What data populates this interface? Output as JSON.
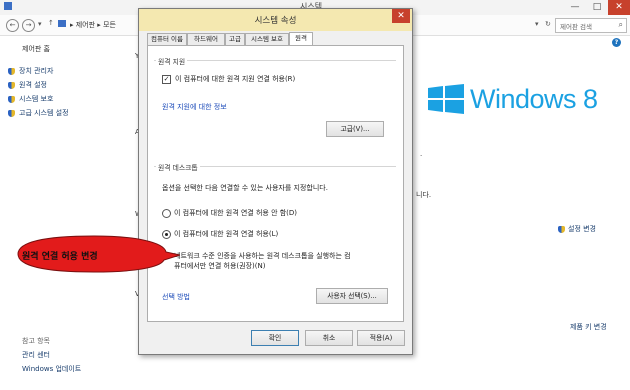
{
  "window": {
    "title": "시스템",
    "minimize": "—",
    "maximize": "□"
  },
  "address": {
    "breadcrumb": "▸ 제어판 ▸ 모든",
    "search_placeholder": "제어판 검색"
  },
  "sidebar": {
    "home": "제어판 홈",
    "items": [
      {
        "label": "장치 관리자"
      },
      {
        "label": "원격 설정"
      },
      {
        "label": "시스템 보호"
      },
      {
        "label": "고급 시스템 설정"
      }
    ],
    "see_also": "참고 항목",
    "action_center": "관리 센터",
    "windows_update": "Windows 업데이트"
  },
  "main": {
    "windows_logo": "Windows 8",
    "fragment_1": "니다.",
    "settings_change": "설정 변경",
    "product_key": "제품 키 변경",
    "letters": [
      "Y",
      "A",
      "W",
      "P",
      "V"
    ]
  },
  "dialog": {
    "title": "시스템 속성",
    "close": "✕",
    "tabs": [
      "컴퓨터 이름",
      "하드웨어",
      "고급",
      "시스템 보호",
      "원격"
    ],
    "remote_assistance": {
      "group": "원격 지원",
      "checkbox": "이 컴퓨터에 대한 원격 지원 연결 허용(R)",
      "checked": true,
      "info_link": "원격 지원에 대한 정보",
      "advanced": "고급(V)..."
    },
    "remote_desktop": {
      "group": "원격 데스크톱",
      "instruction": "옵션을 선택한 다음 연결할 수 있는 사용자를 지정합니다.",
      "option_off": "이 컴퓨터에 대한 원격 연결 허용 안 함(D)",
      "option_on": "이 컴퓨터에 대한 원격 연결 허용(L)",
      "nla_line1": "네트워크 수준 인증을 사용하는 원격 데스크톱을 실행하는 컴",
      "nla_line2": "퓨터에서만 연결 허용(권장)(N)",
      "help_link": "선택 방법",
      "select_users": "사용자 선택(S)..."
    },
    "ok": "확인",
    "cancel": "취소",
    "apply": "적용(A)"
  },
  "callout": {
    "text": "원격 연결 허용 변경",
    "color": "#e21b1b"
  }
}
